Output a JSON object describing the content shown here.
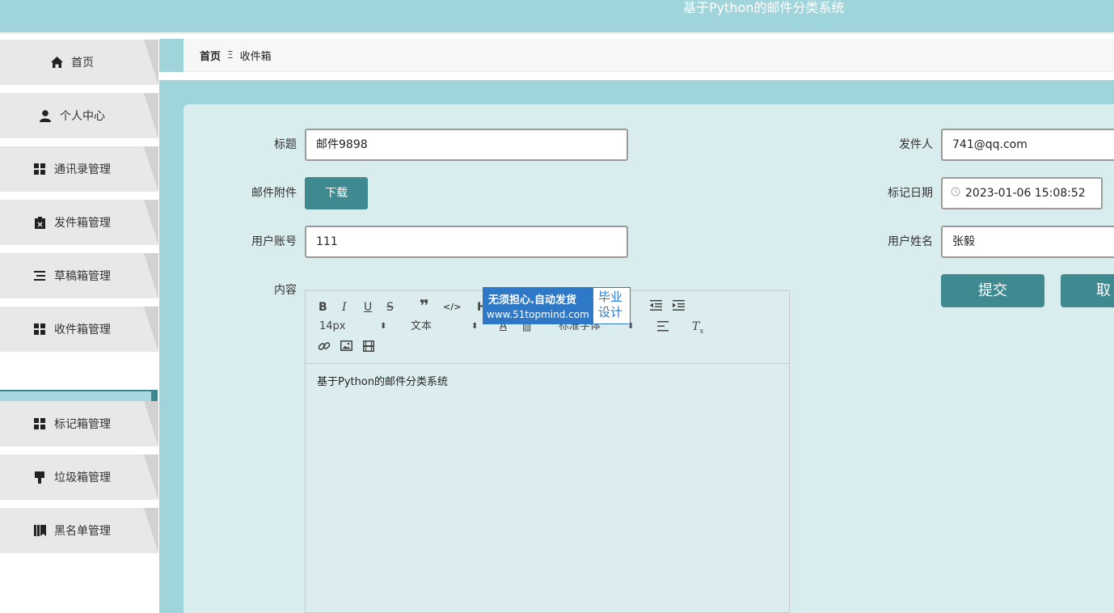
{
  "app": {
    "title": "基于Python的邮件分类系统"
  },
  "sidebar": {
    "items": [
      {
        "label": "首页",
        "icon": "home-icon"
      },
      {
        "label": "个人中心",
        "icon": "user-icon"
      },
      {
        "label": "通讯录管理",
        "icon": "grid-icon"
      },
      {
        "label": "发件箱管理",
        "icon": "clipboard-icon"
      },
      {
        "label": "草稿箱管理",
        "icon": "list-icon"
      },
      {
        "label": "收件箱管理",
        "icon": "grid-icon"
      },
      {
        "label": "标记箱管理",
        "icon": "grid-icon"
      },
      {
        "label": "垃圾箱管理",
        "icon": "brush-icon"
      },
      {
        "label": "黑名单管理",
        "icon": "book-icon"
      }
    ],
    "submenu_active": "收件箱"
  },
  "breadcrumb": {
    "home": "首页",
    "separator": "Ξ",
    "current": "收件箱"
  },
  "form": {
    "title_label": "标题",
    "title_value": "邮件9898",
    "attachment_label": "邮件附件",
    "download_label": "下载",
    "account_label": "用户账号",
    "account_value": "111",
    "content_label": "内容",
    "sender_label": "发件人",
    "sender_value": "741@qq.com",
    "date_label": "标记日期",
    "date_value": "2023-01-06 15:08:52",
    "username_label": "用户姓名",
    "username_value": "张毅",
    "submit_label": "提交",
    "cancel_label": "取消"
  },
  "editor": {
    "font_size": "14px",
    "text_type": "文本",
    "font_family": "标准字体",
    "content": "基于Python的邮件分类系统"
  },
  "watermark": {
    "line1": "无须担心.自动发货",
    "line2": "www.51topmind.com",
    "line3": "毕业设计"
  },
  "colors": {
    "accent": "#3f8a91",
    "topbar": "#a0d5dc",
    "card": "#d9edef"
  }
}
